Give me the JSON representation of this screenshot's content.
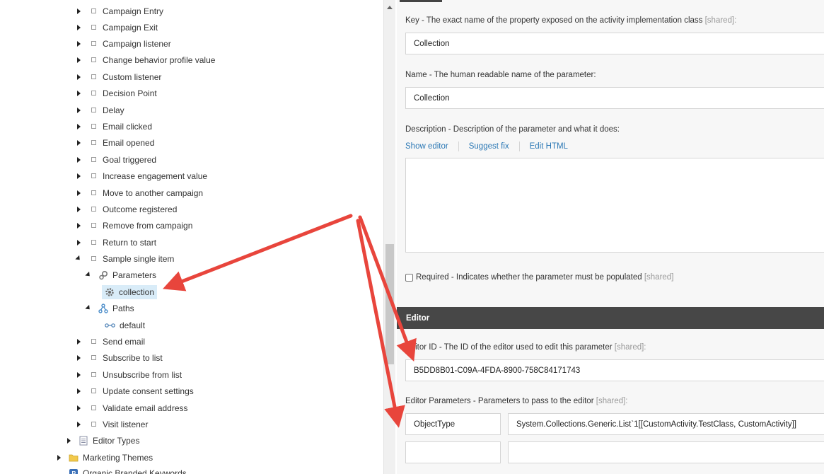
{
  "tree": {
    "items": [
      {
        "label": "Campaign Entry"
      },
      {
        "label": "Campaign Exit"
      },
      {
        "label": "Campaign listener"
      },
      {
        "label": "Change behavior profile value"
      },
      {
        "label": "Custom listener"
      },
      {
        "label": "Decision Point"
      },
      {
        "label": "Delay"
      },
      {
        "label": "Email clicked"
      },
      {
        "label": "Email opened"
      },
      {
        "label": "Goal triggered"
      },
      {
        "label": "Increase engagement value"
      },
      {
        "label": "Move to another campaign"
      },
      {
        "label": "Outcome registered"
      },
      {
        "label": "Remove from campaign"
      },
      {
        "label": "Return to start"
      },
      {
        "label": "Sample single item"
      },
      {
        "label": "Parameters"
      },
      {
        "label": "collection"
      },
      {
        "label": "Paths"
      },
      {
        "label": "default"
      },
      {
        "label": "Send email"
      },
      {
        "label": "Subscribe to list"
      },
      {
        "label": "Unsubscribe from list"
      },
      {
        "label": "Update consent settings"
      },
      {
        "label": "Validate email address"
      },
      {
        "label": "Visit listener"
      },
      {
        "label": "Editor Types"
      },
      {
        "label": "Marketing Themes"
      },
      {
        "label": "Organic Branded Keywords"
      }
    ]
  },
  "form": {
    "key": {
      "label": "Key - The exact name of the property exposed on the activity implementation class",
      "shared": "[shared]:",
      "value": "Collection"
    },
    "name": {
      "label": "Name - The human readable name of the parameter:",
      "value": "Collection"
    },
    "description": {
      "label": "Description - Description of the parameter and what it does:",
      "links": [
        "Show editor",
        "Suggest fix",
        "Edit HTML"
      ]
    },
    "required": {
      "label": "Required - Indicates whether the parameter must be populated",
      "shared": "[shared]",
      "checked": false
    },
    "editor_section": {
      "title": "Editor"
    },
    "editor_id": {
      "label": "Editor ID - The ID of the editor used to edit this parameter",
      "shared": "[shared]:",
      "value": "B5DD8B01-C09A-4FDA-8900-758C84171743"
    },
    "editor_parameters": {
      "label": "Editor Parameters - Parameters to pass to the editor",
      "shared": "[shared]:",
      "rows": [
        {
          "key": "ObjectType",
          "value": "System.Collections.Generic.List`1[[CustomActivity.TestClass, CustomActivity]]"
        },
        {
          "key": "",
          "value": ""
        }
      ]
    }
  },
  "colors": {
    "arrow": "#e8453c",
    "link": "#2b78b5",
    "section_header": "#474747",
    "selection": "#d9ecf8"
  }
}
